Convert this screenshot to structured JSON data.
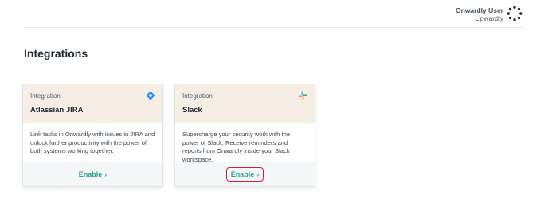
{
  "header": {
    "user_name": "Onwardly User",
    "org_name": "Upwardly",
    "logo_icon": "ring-of-dots-logo"
  },
  "page": {
    "title": "Integrations"
  },
  "integrations": [
    {
      "kicker": "Integration",
      "title": "Atlassian JIRA",
      "icon": "jira-diamond-icon",
      "description": "Link tasks in Onwardly with issues in JIRA and unlock further productivity with the power of both systems working together.",
      "action_label": "Enable",
      "action_chevron": "›"
    },
    {
      "kicker": "Integration",
      "title": "Slack",
      "icon": "slack-icon",
      "description": "Supercharge your security work with the power of Slack. Receive reminders and reports from Onwardly inside your Slack workspace.",
      "action_label": "Enable",
      "action_chevron": "›"
    }
  ],
  "colors": {
    "accent": "#2a9d8f",
    "card_header_bg": "#f6ede5",
    "card_footer_bg": "#f4f7f8",
    "highlight_border": "#d0222e"
  }
}
